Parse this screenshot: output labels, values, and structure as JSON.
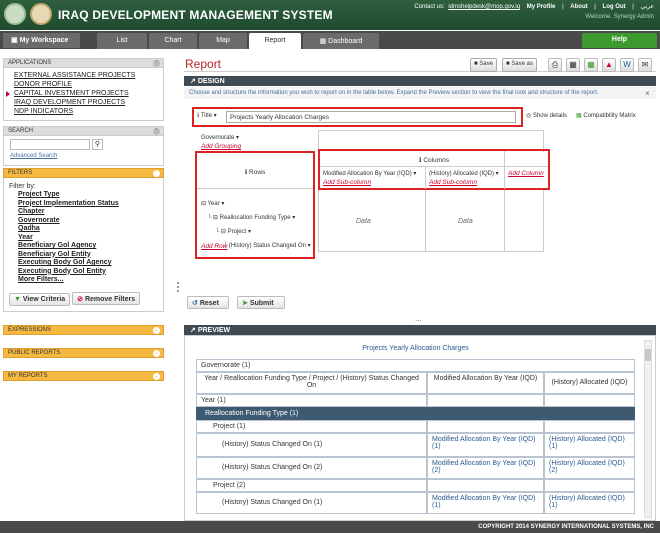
{
  "app": {
    "title": "IRAQ DEVELOPMENT MANAGEMENT SYSTEM"
  },
  "toplinks": {
    "contact": "Contact us:",
    "email": "idmshelpdesk@mop.gov.iq",
    "profile": "My Profile",
    "about": "About",
    "logout": "Log Out",
    "lang": "عربي",
    "welcome": "Welcome, Synergy Admin"
  },
  "nav": {
    "workspace": "My Workspace",
    "tabs": [
      "List",
      "Chart",
      "Map",
      "Report",
      "Dashboard"
    ],
    "help": "Help"
  },
  "sidebar": {
    "applications": {
      "header": "APPLICATIONS",
      "items": [
        "EXTERNAL ASSISTANCE PROJECTS",
        "DONOR PROFILE",
        "CAPITAL INVESTMENT PROJECTS",
        "IRAQ DEVELOPMENT PROJECTS",
        "NDP INDICATORS"
      ]
    },
    "search": {
      "header": "SEARCH",
      "advanced": "Advanced Search"
    },
    "filters": {
      "header": "FILTERS",
      "filter_by": "Filter by:",
      "items": [
        "Project Type",
        "Project Implementation Status",
        "Chapter",
        "Governorate",
        "Qadha",
        "Year",
        "Beneficiary Gol Agency",
        "Beneficiary Gol Entity",
        "Executing Body Gol Agency",
        "Executing Body Gol Entity",
        "More Filters..."
      ],
      "view": "View Criteria",
      "remove": "Remove Filters"
    },
    "expressions": "EXPRESSIONS",
    "public_reports": "PUBLIC REPORTS",
    "my_reports": "MY REPORTS"
  },
  "report": {
    "title": "Report",
    "toolbar": {
      "save": "Save",
      "save_as": "Save as"
    },
    "design": "DESIGN",
    "info": "Choose and structure the information you wish to report on in the table below. Expand the Preview section to view the final look and structure of the report.",
    "title_label": "Title",
    "title_value": "Projects Yearly Allocation Charges",
    "show_details": "Show details",
    "compat": "Compatibility Matrix",
    "governorate": "Governorate",
    "add_grouping": "Add Grouping",
    "rows_label": "Rows",
    "row_items": [
      "Year",
      "Reallocation Funding Type",
      "Project",
      "(History) Status Changed On"
    ],
    "add_row": "Add Row",
    "columns_label": "Columns",
    "col_items": [
      "Modified Allocation By Year (IQD)",
      "(History) Allocated (IQD)"
    ],
    "add_column": "Add Column",
    "add_subcolumn": "Add Sub-column",
    "data": "Data",
    "reset": "Reset",
    "submit": "Submit"
  },
  "preview": {
    "header": "PREVIEW",
    "title": "Projects Yearly Allocation Charges",
    "group": "Governorate (1)",
    "col_headers": [
      "Year / Reallocation Funding Type / Project / (History) Status Changed On",
      "Modified Allocation By Year (IQD)",
      "(History) Allocated (IQD)"
    ],
    "year": "Year (1)",
    "funding": "Reallocation Funding Type (1)",
    "project1": "Project (1)",
    "rows": [
      [
        "(History) Status Changed On (1)",
        "Modified Allocation By Year (IQD) (1)",
        "(History) Allocated (IQD) (1)"
      ],
      [
        "(History) Status Changed On (2)",
        "Modified Allocation By Year (IQD) (2)",
        "(History) Allocated (IQD) (2)"
      ]
    ],
    "project2": "Project (2)",
    "rows2": [
      [
        "(History) Status Changed On (1)",
        "Modified Allocation By Year (IQD) (1)",
        "(History) Allocated (IQD) (1)"
      ]
    ]
  },
  "footer": "COPYRIGHT 2014 SYNERGY INTERNATIONAL SYSTEMS, INC"
}
